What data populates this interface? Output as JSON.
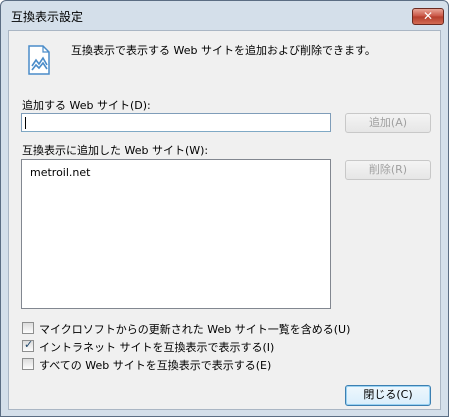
{
  "window": {
    "title": "互換表示設定",
    "close_glyph": "✕"
  },
  "intro": {
    "icon": "web-page-icon",
    "text": "互換表示で表示する Web サイトを追加および削除できます。"
  },
  "add_site": {
    "label": "追加する Web サイト(D):",
    "value": "",
    "add_button": "追加(A)",
    "add_button_enabled": false
  },
  "site_list": {
    "label": "互換表示に追加した Web サイト(W):",
    "items": [
      "metroil.net"
    ],
    "remove_button": "削除(R)",
    "remove_button_enabled": false
  },
  "options": [
    {
      "label": "マイクロソフトからの更新された Web サイト一覧を含める(U)",
      "checked": false
    },
    {
      "label": "イントラネット サイトを互換表示で表示する(I)",
      "checked": true
    },
    {
      "label": "すべての Web サイトを互換表示で表示する(E)",
      "checked": false
    }
  ],
  "check_glyph": "✓",
  "footer": {
    "close_button": "閉じる(C)"
  },
  "colors": {
    "frame": "#d4dfea",
    "close_red": "#c75040",
    "input_border": "#7f9db9",
    "default_button_border": "#3c7fb1"
  }
}
